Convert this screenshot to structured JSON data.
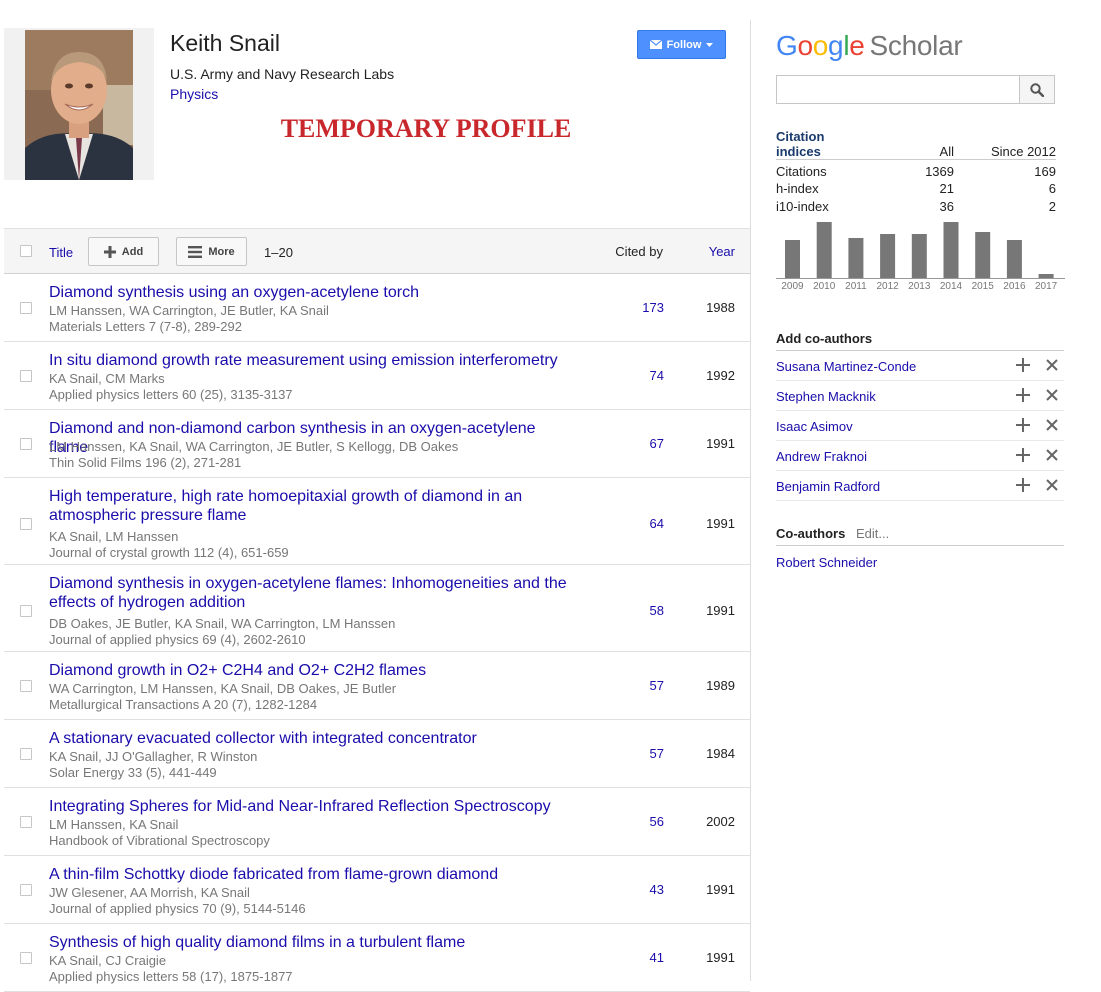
{
  "profile": {
    "name": "Keith Snail",
    "affiliation": "U.S. Army and Navy Research Labs",
    "interest": "Physics",
    "banner": "TEMPORARY PROFILE",
    "follow_label": "Follow"
  },
  "table": {
    "title_label": "Title",
    "add_label": "Add",
    "more_label": "More",
    "range": "1–20",
    "cited_label": "Cited by",
    "year_label": "Year",
    "rows": [
      {
        "title": "Diamond synthesis using an oxygen-acetylene torch",
        "authors": "LM Hanssen, WA Carrington, JE Butler, KA Snail",
        "venue": "Materials Letters 7 (7-8), 289-292",
        "cited": "173",
        "year": "1988"
      },
      {
        "title": "In situ diamond growth rate measurement using emission interferometry",
        "authors": "KA Snail, CM Marks",
        "venue": "Applied physics letters 60 (25), 3135-3137",
        "cited": "74",
        "year": "1992"
      },
      {
        "title": "Diamond and non-diamond carbon synthesis in an oxygen-acetylene flame",
        "authors": "LM Hanssen, KA Snail, WA Carrington, JE Butler, S Kellogg, DB Oakes",
        "venue": "Thin Solid Films 196 (2), 271-281",
        "cited": "67",
        "year": "1991"
      },
      {
        "title": "High temperature, high rate homoepitaxial growth of diamond in an atmospheric pressure flame",
        "authors": "KA Snail, LM Hanssen",
        "venue": "Journal of crystal growth 112 (4), 651-659",
        "cited": "64",
        "year": "1991"
      },
      {
        "title": "Diamond synthesis in oxygen-acetylene flames: Inhomogeneities and the effects of hydrogen addition",
        "authors": "DB Oakes, JE Butler, KA Snail, WA Carrington, LM Hanssen",
        "venue": "Journal of applied physics 69 (4), 2602-2610",
        "cited": "58",
        "year": "1991"
      },
      {
        "title": "Diamond growth in O2+ C2H4 and O2+ C2H2 flames",
        "authors": "WA Carrington, LM Hanssen, KA Snail, DB Oakes, JE Butler",
        "venue": "Metallurgical Transactions A 20 (7), 1282-1284",
        "cited": "57",
        "year": "1989"
      },
      {
        "title": "A stationary evacuated collector with integrated concentrator",
        "authors": "KA Snail, JJ O'Gallagher, R Winston",
        "venue": "Solar Energy 33 (5), 441-449",
        "cited": "57",
        "year": "1984"
      },
      {
        "title": "Integrating Spheres for Mid-and Near-Infrared Reflection Spectroscopy",
        "authors": "LM Hanssen, KA Snail",
        "venue": "Handbook of Vibrational Spectroscopy",
        "cited": "56",
        "year": "2002"
      },
      {
        "title": "A thin-film Schottky diode fabricated from flame-grown diamond",
        "authors": "JW Glesener, AA Morrish, KA Snail",
        "venue": "Journal of applied physics 70 (9), 5144-5146",
        "cited": "43",
        "year": "1991"
      },
      {
        "title": "Synthesis of high quality diamond films in a turbulent flame",
        "authors": "KA Snail, CJ Craigie",
        "venue": "Applied physics letters 58 (17), 1875-1877",
        "cited": "41",
        "year": "1991"
      }
    ]
  },
  "brand": {
    "google": "Google",
    "scholar": "Scholar"
  },
  "search": {
    "placeholder": "",
    "value": ""
  },
  "citations": {
    "heading": "Citation indices",
    "col_all": "All",
    "col_since": "Since 2012",
    "rows": [
      {
        "label": "Citations",
        "all": "1369",
        "since": "169"
      },
      {
        "label": "h-index",
        "all": "21",
        "since": "6"
      },
      {
        "label": "i10-index",
        "all": "36",
        "since": "2"
      }
    ]
  },
  "chart_data": {
    "type": "bar",
    "categories": [
      "2009",
      "2010",
      "2011",
      "2012",
      "2013",
      "2014",
      "2015",
      "2016",
      "2017"
    ],
    "values": [
      38,
      56,
      40,
      44,
      44,
      56,
      46,
      38,
      4
    ],
    "ylim": [
      0,
      60
    ],
    "color": "#777777",
    "grid": false
  },
  "add_coauthors": {
    "heading": "Add co-authors",
    "items": [
      "Susana Martinez-Conde",
      "Stephen Macknik",
      "Isaac Asimov",
      "Andrew Fraknoi",
      "Benjamin Radford"
    ]
  },
  "coauthors": {
    "heading": "Co-authors",
    "edit_label": "Edit...",
    "items": [
      "Robert Schneider"
    ]
  },
  "colors": {
    "link": "#1a0dab",
    "accent": "#4d90fe",
    "banner": "#c8282c"
  }
}
